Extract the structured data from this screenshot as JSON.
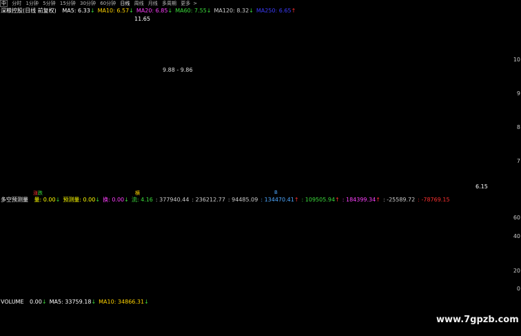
{
  "toolbar": {
    "left_icon": "中",
    "periods": [
      "分时",
      "1分钟",
      "5分钟",
      "15分钟",
      "30分钟",
      "60分钟",
      "日线",
      "周线",
      "月线",
      "多周期",
      "更多"
    ],
    "active_period": "日线",
    "more_arrow": ">"
  },
  "main_chart": {
    "title": "深粮控股(日线 前复权)",
    "mas": [
      {
        "label": "MA5: 6.33",
        "arrow": "↓",
        "color": "#ffffff"
      },
      {
        "label": "MA10: 6.57",
        "arrow": "↓",
        "color": "#ffd400"
      },
      {
        "label": "MA20: 6.85",
        "arrow": "↓",
        "color": "#ff40ff"
      },
      {
        "label": "MA60: 7.55",
        "arrow": "↓",
        "color": "#3cdc3c"
      },
      {
        "label": "MA120: 8.32",
        "arrow": "↓",
        "color": "#cccccc"
      },
      {
        "label": "MA250: 6.65",
        "arrow": "↑",
        "color": "#3c3cff"
      }
    ],
    "high_label": "11.65",
    "range_label": "9.88 - 9.86",
    "low_label": "6.15",
    "y_labels": [
      "10",
      "9",
      "8",
      "7"
    ]
  },
  "indicator": {
    "title": "多空预测量",
    "fields": [
      {
        "label": "量: 0.00",
        "arrow": "↓",
        "color": "#ffff00"
      },
      {
        "label": "预测量: 0.00",
        "arrow": "↓",
        "color": "#ffff00"
      },
      {
        "label": "换: 0.00",
        "arrow": "↓",
        "color": "#ff40ff"
      },
      {
        "label": "流: 4.16",
        "arrow": "",
        "color": "#3cdc3c"
      },
      {
        "label": ": 377940.44",
        "arrow": "",
        "color": "#cccccc"
      },
      {
        "label": ": 236212.77",
        "arrow": "",
        "color": "#cccccc"
      },
      {
        "label": ": 94485.09",
        "arrow": "",
        "color": "#cccccc"
      },
      {
        "label": ": 134470.41",
        "arrow": "↑",
        "color": "#4ea8ff"
      },
      {
        "label": ": 109505.94",
        "arrow": "↑",
        "color": "#3cdc3c"
      },
      {
        "label": ": 184399.34",
        "arrow": "↑",
        "color": "#ff40ff"
      },
      {
        "label": ": -25589.72",
        "arrow": "",
        "color": "#cccccc"
      },
      {
        "label": ": -78769.15",
        "arrow": "",
        "color": "#ff3030"
      }
    ],
    "badges": [
      {
        "text": "涨",
        "color": "#ff3030"
      },
      {
        "text": "跌",
        "color": "#3cdc3c"
      },
      {
        "text": "横",
        "color": "#ffd400"
      },
      {
        "text": "B",
        "color": "#4ea8ff"
      }
    ],
    "y_labels": [
      "60",
      "40",
      "20",
      "0"
    ]
  },
  "volume": {
    "title": "VOLUME",
    "fields": [
      {
        "label": "0.00",
        "arrow": "↓",
        "color": "#ffffff"
      },
      {
        "label": "MA5: 33759.18",
        "arrow": "↓",
        "color": "#ffffff"
      },
      {
        "label": "MA10: 34866.31",
        "arrow": "↓",
        "color": "#ffd400"
      }
    ]
  },
  "watermark": "www.7gpzb.com"
}
